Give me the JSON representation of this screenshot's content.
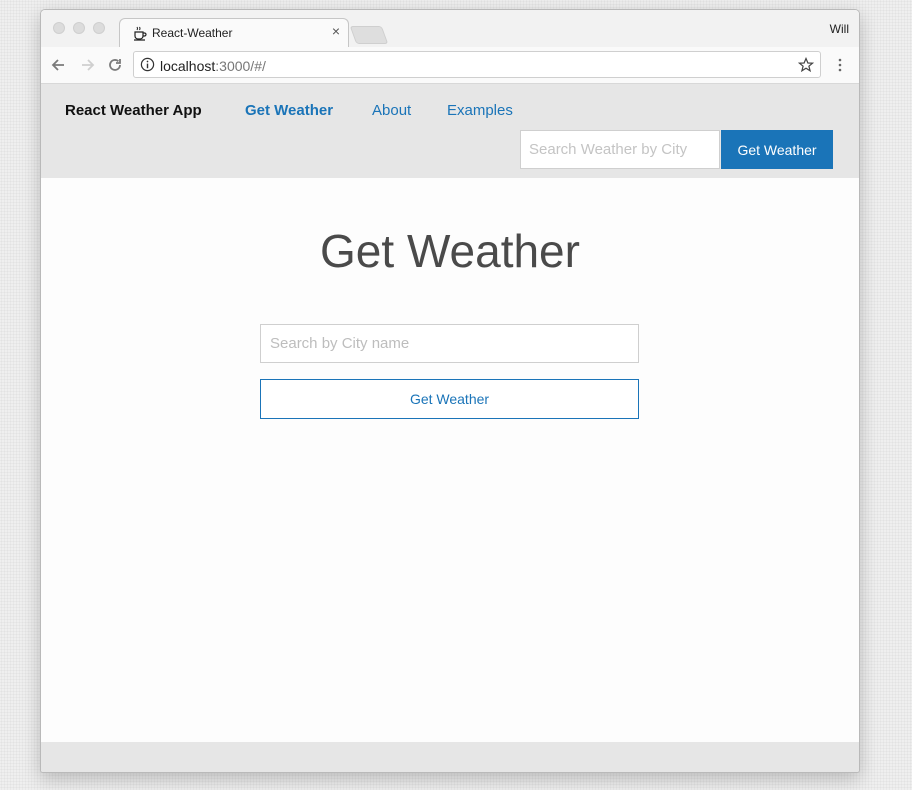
{
  "browser": {
    "tab_title": "React-Weather",
    "profile_name": "Will",
    "url_host": "localhost",
    "url_rest": ":3000/#/"
  },
  "nav": {
    "brand": "React Weather App",
    "links": [
      "Get Weather",
      "About",
      "Examples"
    ],
    "active_link": "Get Weather",
    "search_placeholder": "Search Weather by City",
    "search_button": "Get Weather"
  },
  "main": {
    "title": "Get Weather",
    "city_placeholder": "Search by City name",
    "button_label": "Get Weather"
  },
  "colors": {
    "accent": "#1a74b8",
    "navbar_bg": "#e6e6e6",
    "title_text": "#4a4a4a"
  },
  "icons": [
    "coffee-cup-favicon-icon",
    "close-icon",
    "back-arrow-icon",
    "forward-arrow-icon",
    "reload-icon",
    "info-icon",
    "star-icon",
    "menu-dots-icon"
  ]
}
